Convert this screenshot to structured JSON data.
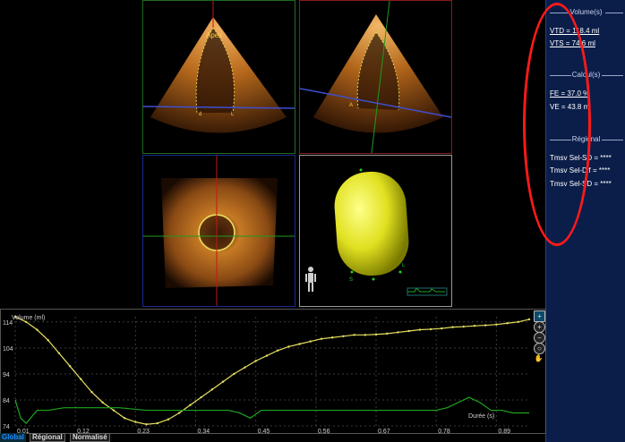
{
  "views": {
    "apex_label": "Apex",
    "marker_d": "d",
    "marker_l": "L",
    "marker_a": "A",
    "marker_s": "S"
  },
  "side_panel": {
    "volume_header": "Volume(s)",
    "vtd": "VTD = 118.4 ml",
    "vts": "VTS = 74.6 ml",
    "calcul_header": "Calcul(s)",
    "fe": "FE = 37.0 %",
    "ve": "VE = 43.8 ml",
    "regional_header": "Régional",
    "tmsv_sel_sd_1": "Tmsv Sel-SD = ****",
    "tmsv_sel_dif": "Tmsv Sel-Dif = ****",
    "tmsv_sel_sd_2": "Tmsv Sel-SD = ****"
  },
  "tabs": {
    "global": "Global",
    "regional": "Régional",
    "normalise": "Normalisé"
  },
  "chart_data": {
    "type": "line",
    "title": "Volume (ml)",
    "xlabel": "Durée (s)",
    "ylim": [
      74,
      116
    ],
    "xlim": [
      0.01,
      0.95
    ],
    "y_ticks": [
      "114",
      "104",
      "94",
      "84",
      "74"
    ],
    "x_ticks": [
      "0.01",
      "0.12",
      "0.23",
      "0.34",
      "0.45",
      "0.56",
      "0.67",
      "0.78",
      "0.89"
    ],
    "series": [
      {
        "color": "#e6e060",
        "x": [
          0.01,
          0.03,
          0.05,
          0.07,
          0.09,
          0.11,
          0.13,
          0.15,
          0.17,
          0.19,
          0.21,
          0.23,
          0.25,
          0.27,
          0.29,
          0.31,
          0.33,
          0.35,
          0.37,
          0.39,
          0.41,
          0.43,
          0.45,
          0.47,
          0.49,
          0.51,
          0.53,
          0.55,
          0.57,
          0.59,
          0.61,
          0.63,
          0.65,
          0.67,
          0.69,
          0.71,
          0.73,
          0.75,
          0.77,
          0.79,
          0.81,
          0.83,
          0.85,
          0.87,
          0.89,
          0.91,
          0.93,
          0.95
        ],
        "values": [
          116,
          114,
          111,
          107,
          102,
          97,
          92,
          87,
          83,
          80,
          77,
          75.5,
          74.6,
          75,
          76.5,
          79,
          82,
          85,
          88,
          91,
          94,
          96.5,
          99,
          101,
          103,
          104.5,
          105.5,
          106.5,
          107.5,
          108,
          108.5,
          109,
          109,
          109.2,
          109.5,
          110,
          110.5,
          111,
          111.2,
          111.5,
          112,
          112.2,
          112.5,
          112.7,
          113,
          113.5,
          114,
          115
        ]
      },
      {
        "color": "#1fa51f",
        "x": [
          0.01,
          0.02,
          0.03,
          0.05,
          0.07,
          0.1,
          0.15,
          0.2,
          0.25,
          0.3,
          0.35,
          0.4,
          0.42,
          0.44,
          0.46,
          0.48,
          0.5,
          0.55,
          0.6,
          0.65,
          0.7,
          0.75,
          0.78,
          0.8,
          0.82,
          0.84,
          0.86,
          0.88,
          0.9,
          0.92,
          0.95
        ],
        "values": [
          84,
          77,
          75,
          80,
          80,
          81,
          81,
          81,
          80,
          80,
          80,
          80,
          79,
          77,
          80,
          80,
          80,
          80,
          80,
          80,
          80,
          80,
          80,
          81,
          83,
          85,
          83,
          80,
          80,
          79,
          79
        ]
      }
    ]
  }
}
